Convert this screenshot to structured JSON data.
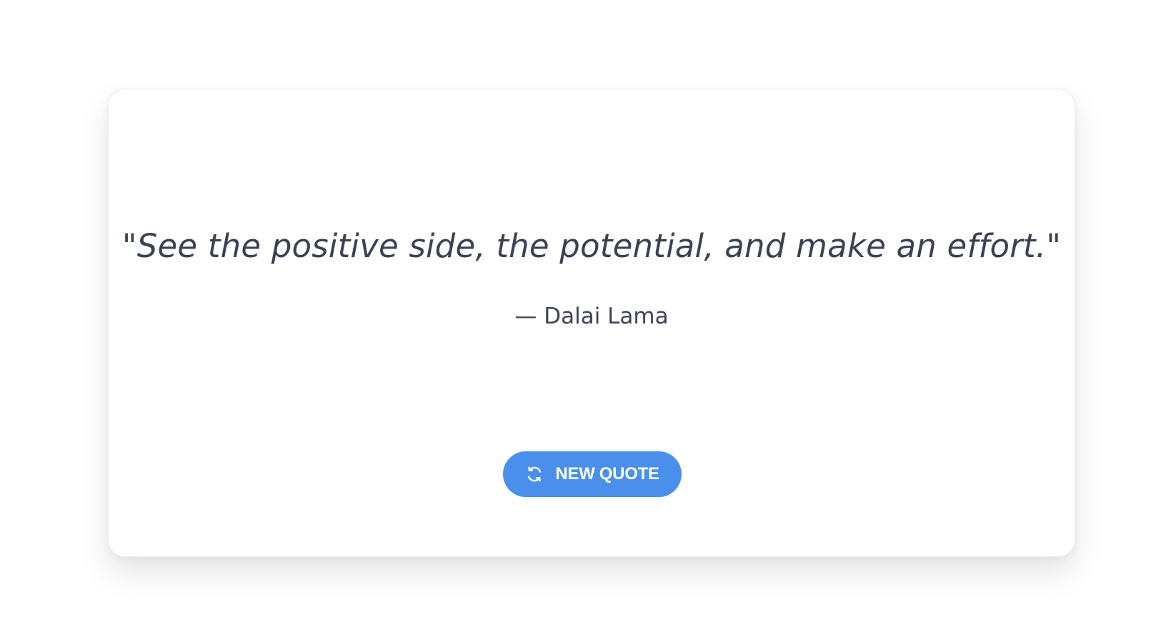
{
  "quote": {
    "text": "\"See the positive side, the potential, and make an effort.\"",
    "author": "— Dalai Lama"
  },
  "button": {
    "label": "NEW QUOTE",
    "icon": "refresh-icon"
  },
  "colors": {
    "button_bg": "#4a8fec",
    "text": "#3a4253",
    "card_bg": "#ffffff"
  }
}
